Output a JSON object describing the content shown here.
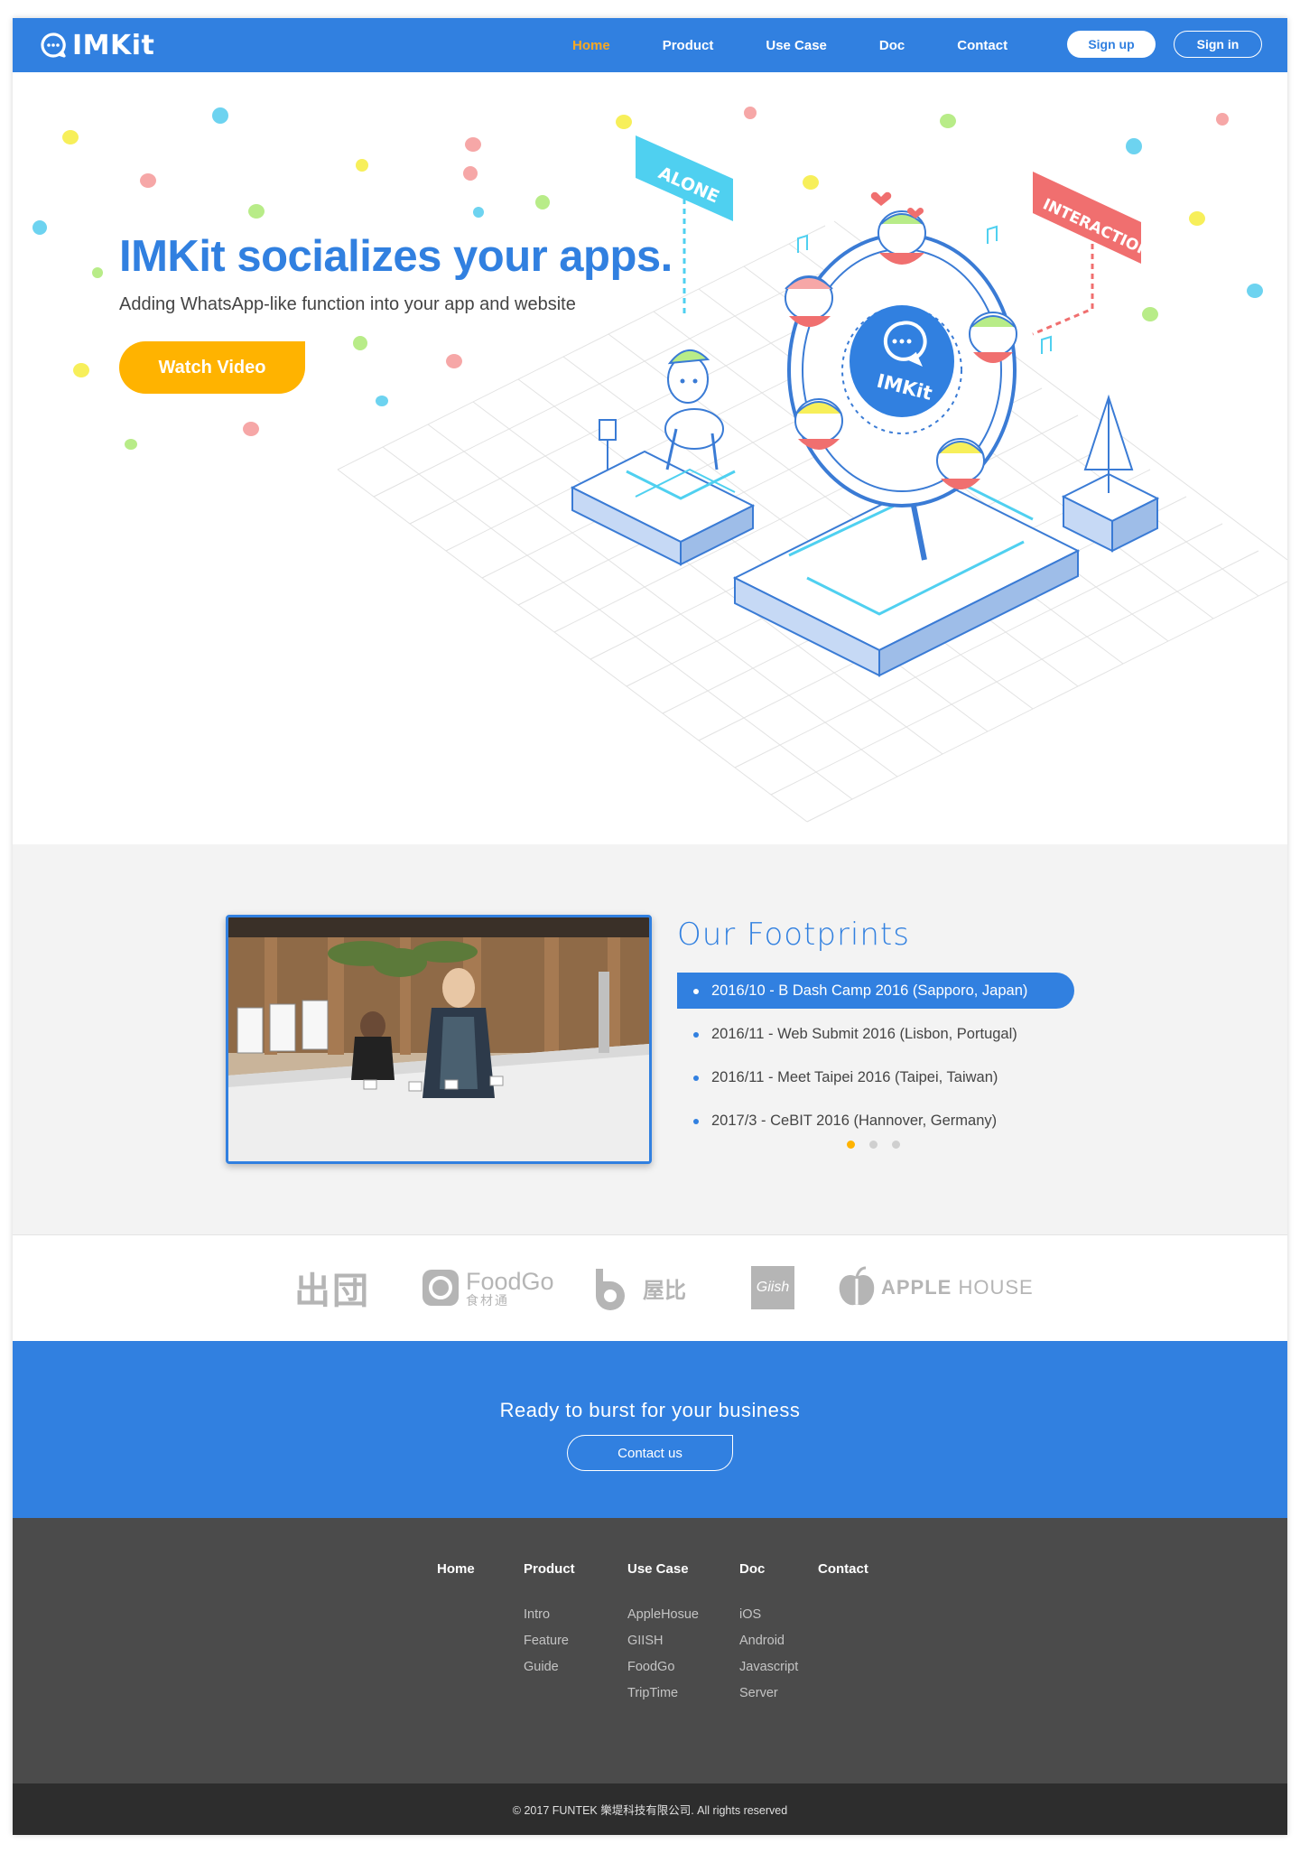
{
  "nav": {
    "logo_text": "IMKit",
    "links": [
      "Home",
      "Product",
      "Use Case",
      "Doc",
      "Contact"
    ],
    "active_link": "Home",
    "signup_label": "Sign up",
    "signin_label": "Sign in"
  },
  "hero": {
    "title": "IMKit socializes your apps.",
    "subtitle": "Adding WhatsApp-like function into your app and website",
    "watch_button": "Watch Video",
    "illustration": {
      "sign_left": "ALONE",
      "sign_right": "INTERACTION",
      "wheel_label": "IMKit"
    }
  },
  "footprints": {
    "title": "Our Footprints",
    "items": [
      "2016/10 - B Dash Camp 2016 (Sapporo, Japan)",
      "2016/11 - Web Submit 2016 (Lisbon, Portugal)",
      "2016/11 - Meet Taipei  2016 (Taipei, Taiwan)",
      "2017/3 - CeBIT 2016 (Hannover, Germany)"
    ],
    "active_index": 0,
    "pager_count": 3,
    "pager_active": 0
  },
  "partners": {
    "chutuan": "出団",
    "foodgo": "FoodGo",
    "foodgo_sub": "食材通",
    "wubi": "屋比",
    "giish": "Giish",
    "apple_house_a": "APPLE",
    "apple_house_b": " HOUSE"
  },
  "cta": {
    "text": "Ready to burst for your business",
    "button": "Contact us"
  },
  "footer": {
    "columns": [
      {
        "head": "Home",
        "links": []
      },
      {
        "head": "Product",
        "links": [
          "Intro",
          "Feature",
          "Guide"
        ]
      },
      {
        "head": "Use Case",
        "links": [
          "AppleHosue",
          "GIISH",
          "FoodGo",
          "TripTime"
        ]
      },
      {
        "head": "Doc",
        "links": [
          "iOS",
          "Android",
          "Javascript",
          "Server"
        ]
      },
      {
        "head": "Contact",
        "links": []
      }
    ],
    "copyright": "© 2017 FUNTEK 樂堤科技有限公司. All rights reserved"
  },
  "colors": {
    "brand_blue": "#3180e0",
    "accent_orange": "#ffb300",
    "footer_dark": "#4b4b4b",
    "copyright_dark": "#2d2d2d"
  }
}
